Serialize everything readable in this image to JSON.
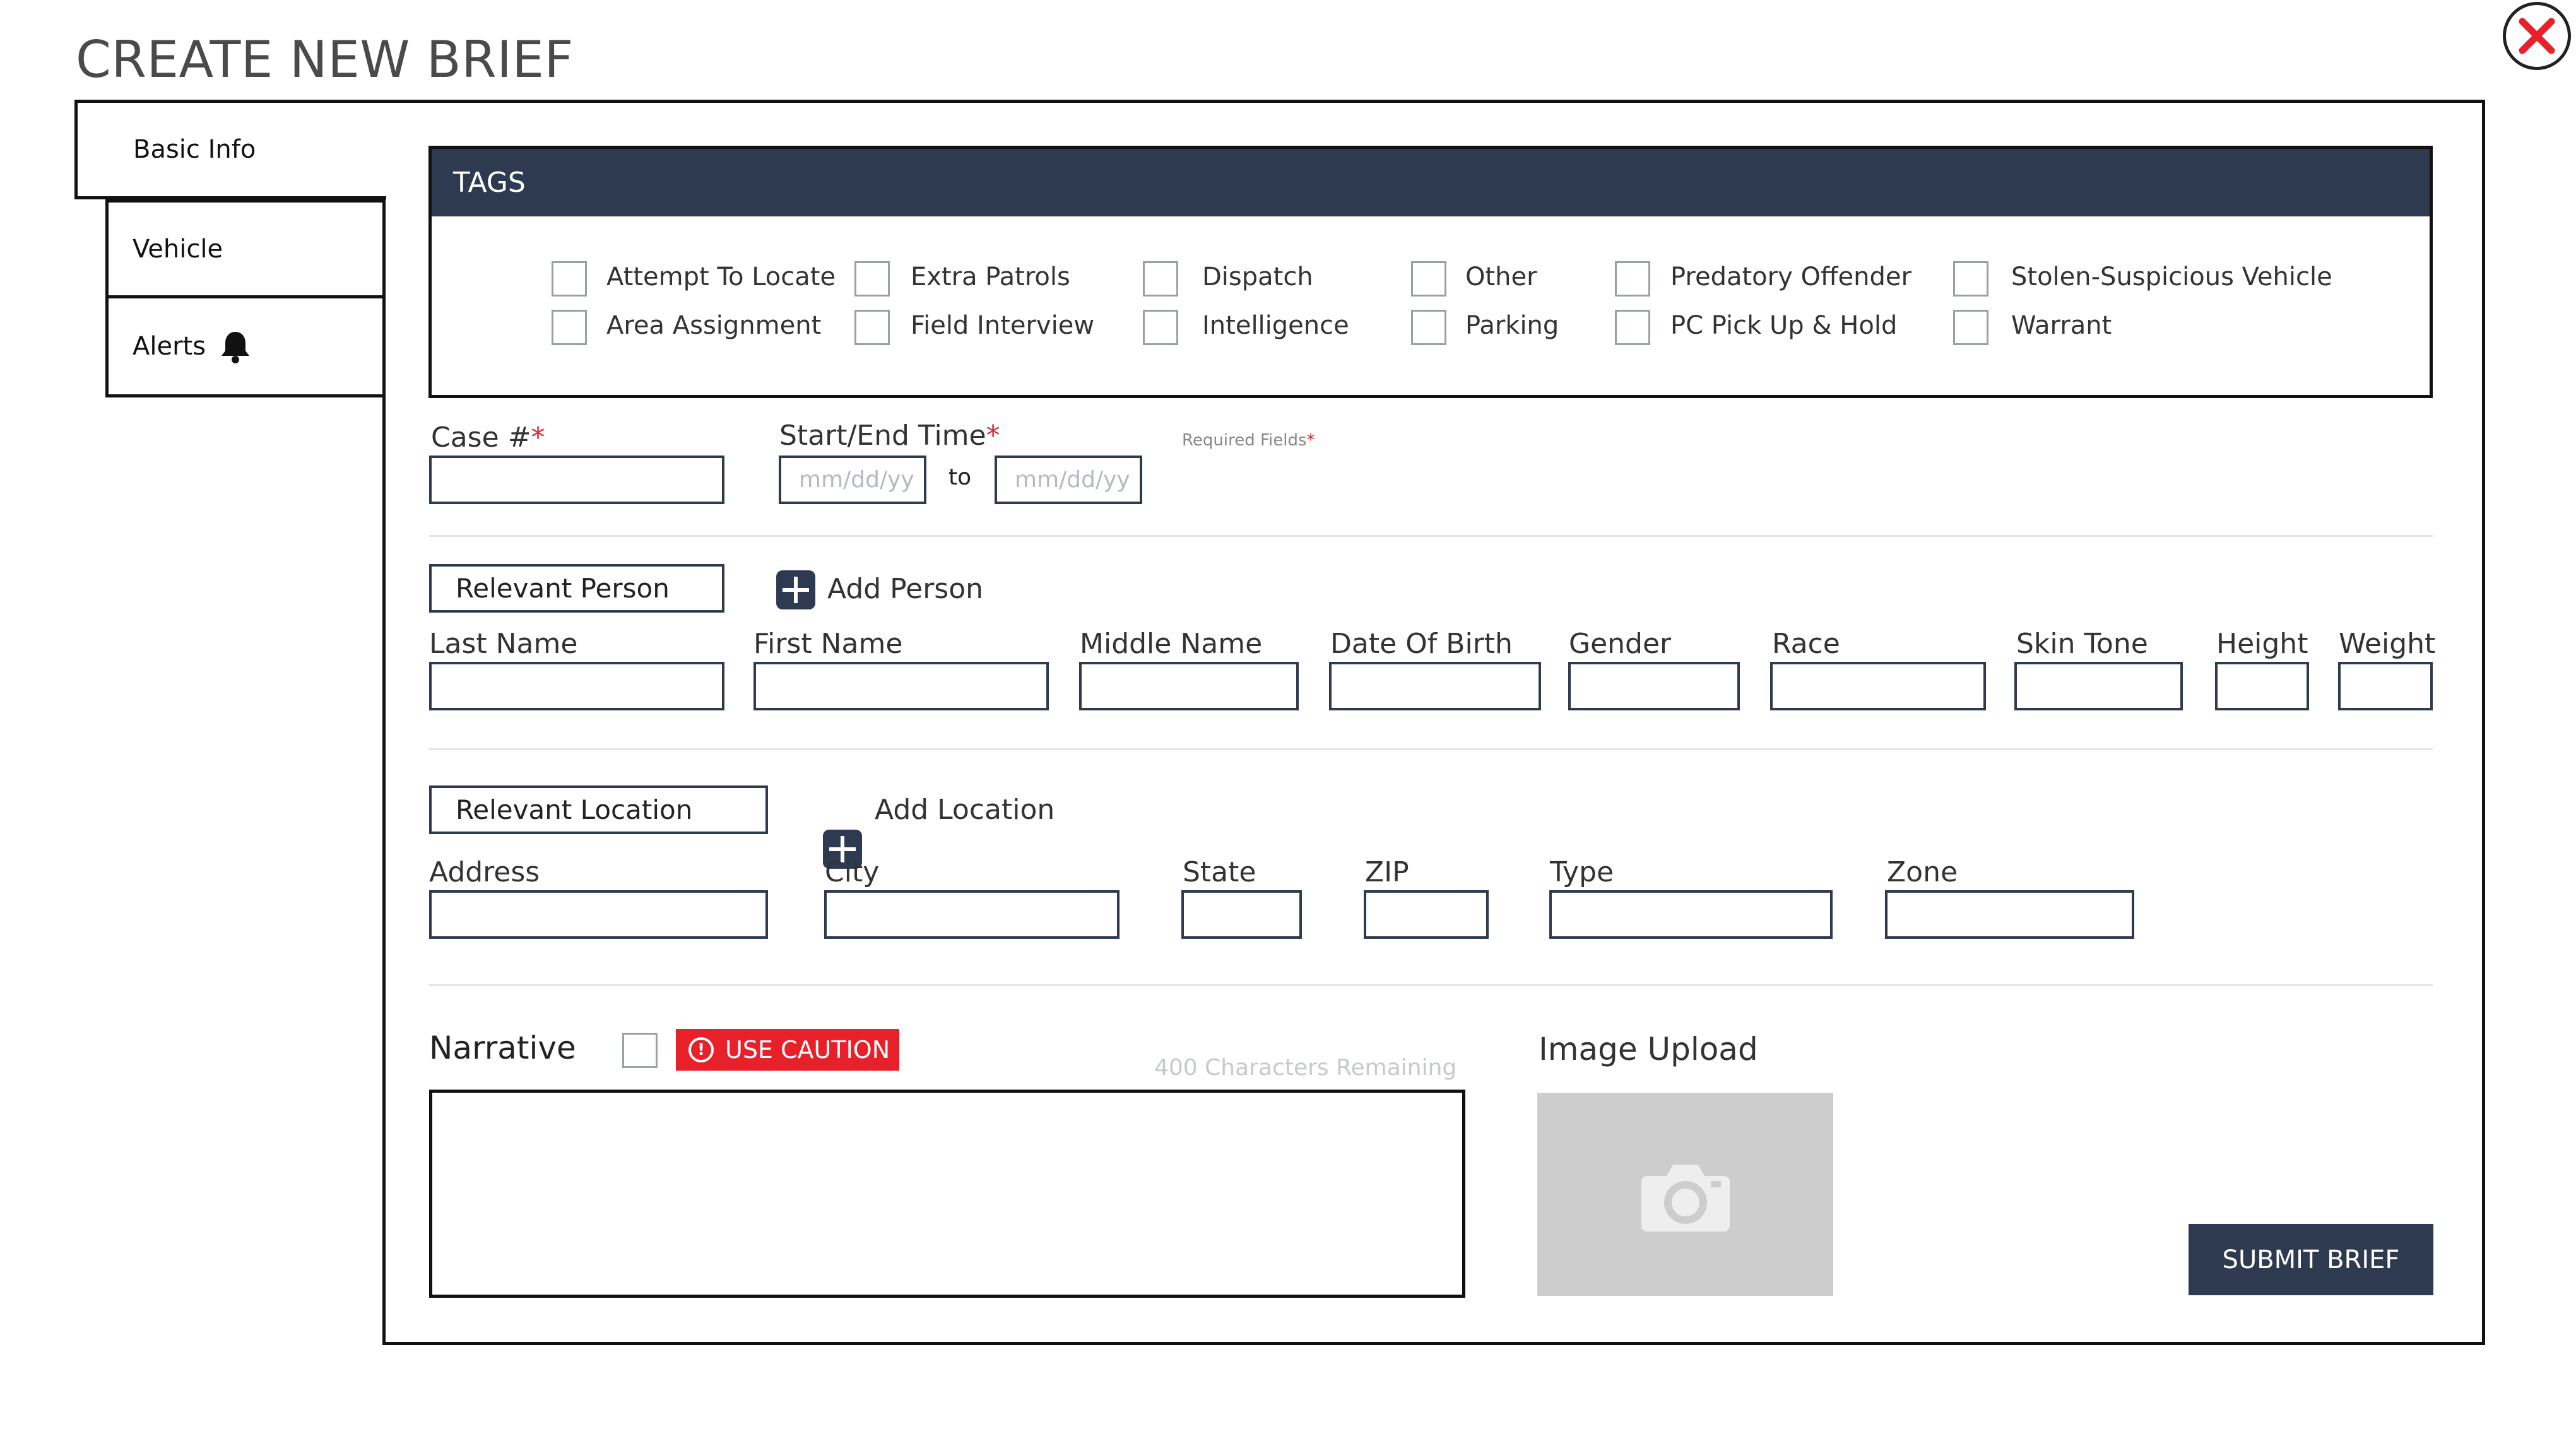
{
  "title": "CREATE NEW BRIEF",
  "tabs": [
    {
      "label": "Basic Info"
    },
    {
      "label": "Vehicle"
    },
    {
      "label": "Alerts"
    }
  ],
  "tags": {
    "header": "TAGS",
    "items": [
      {
        "label": "Attempt To Locate"
      },
      {
        "label": "Area Assignment"
      },
      {
        "label": "Extra Patrols"
      },
      {
        "label": "Field Interview"
      },
      {
        "label": "Dispatch"
      },
      {
        "label": "Intelligence"
      },
      {
        "label": "Other"
      },
      {
        "label": "Parking"
      },
      {
        "label": "Predatory Offender"
      },
      {
        "label": "PC Pick Up & Hold"
      },
      {
        "label": "Stolen-Suspicious Vehicle"
      },
      {
        "label": "Warrant"
      }
    ]
  },
  "case": {
    "label": "Case #",
    "required_mark": "*"
  },
  "time": {
    "label": "Start/End Time",
    "required_mark": "*",
    "start_placeholder": "mm/dd/yy",
    "end_placeholder": "mm/dd/yy",
    "to": "to"
  },
  "required_note": {
    "text": "Required Fields",
    "mark": "*"
  },
  "person": {
    "section": "Relevant Person",
    "add": "Add Person",
    "fields": [
      "Last Name",
      "First Name",
      "Middle Name",
      "Date Of Birth",
      "Gender",
      "Race",
      "Skin Tone",
      "Height",
      "Weight"
    ]
  },
  "location": {
    "section": "Relevant Location",
    "add": "Add Location",
    "fields": [
      "Address",
      "City",
      "State",
      "ZIP",
      "Type",
      "Zone"
    ]
  },
  "narrative": {
    "label": "Narrative",
    "caution": "USE CAUTION",
    "remaining": "400 Characters Remaining"
  },
  "image_upload": {
    "label": "Image Upload"
  },
  "submit_label": "SUBMIT BRIEF",
  "colors": {
    "navy": "#2e3a4f",
    "alert_red": "#e8202a"
  }
}
